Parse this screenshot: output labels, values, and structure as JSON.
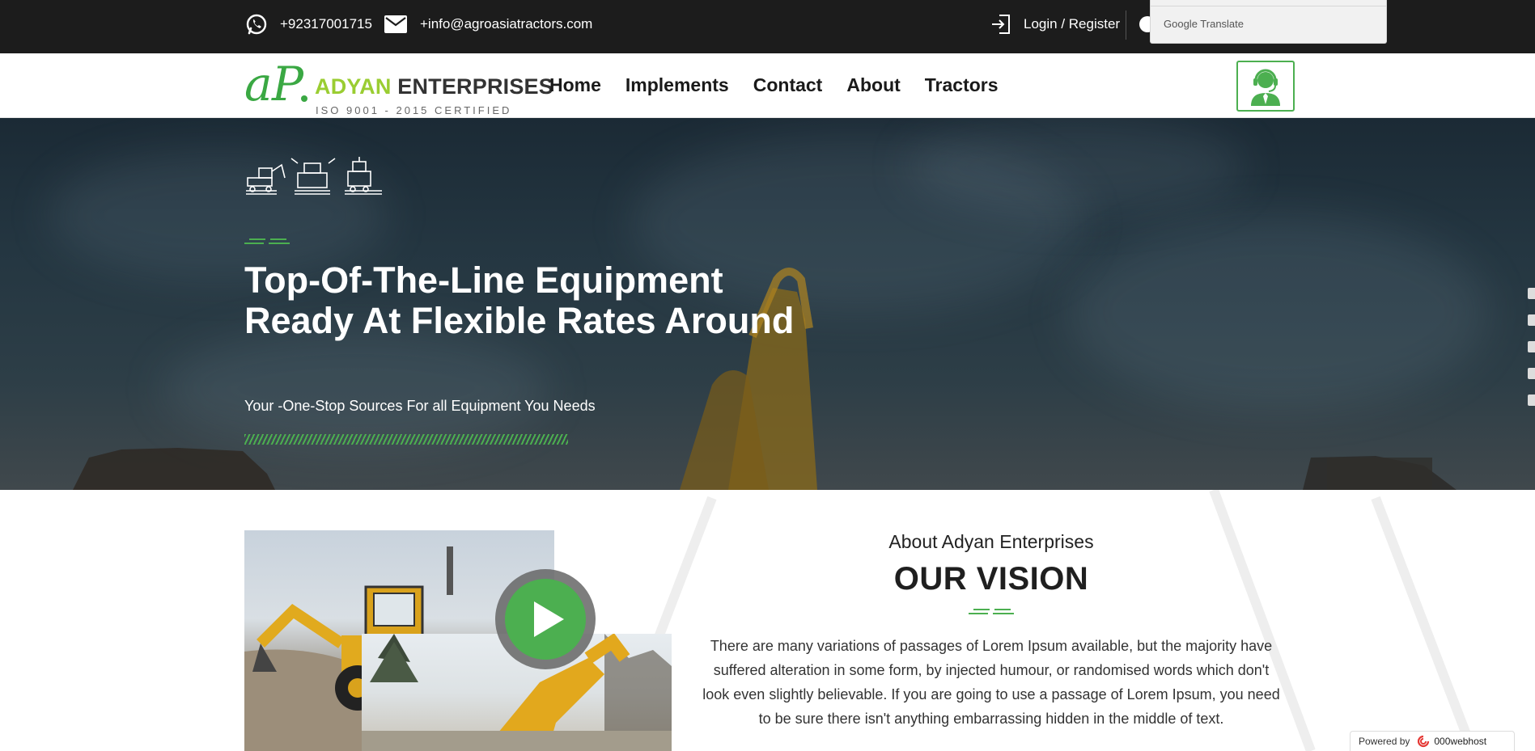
{
  "topbar": {
    "phone": "+92317001715",
    "email": "+info@agroasiatractors.com",
    "login": "Login / Register",
    "translate_label": "Google Translate",
    "icons": [
      "whatsapp-icon",
      "mail-icon",
      "login-icon",
      "globe-icon"
    ]
  },
  "header": {
    "logo_mark": "aP.",
    "logo_brand_1": "ADYAN",
    "logo_brand_2": " ENTERPRISES",
    "logo_cert": "ISO 9001 - 2015 CERTIFIED",
    "nav": [
      "Home",
      "Implements",
      "Contact",
      "About",
      "Tractors"
    ],
    "support_icon": "customer-support-icon"
  },
  "hero": {
    "title": "Top-Of-The-Line Equipment Ready At Flexible Rates Around",
    "subtitle": "Your -One-Stop Sources For all Equipment You Needs",
    "icons": [
      "excavator-line-icon",
      "tractor-line-icon",
      "combine-line-icon"
    ]
  },
  "about": {
    "eyebrow": "About Adyan Enterprises",
    "heading": "OUR VISION",
    "body": "There are many variations of passages of Lorem Ipsum available, but the majority have suffered alteration in some form, by injected humour, or randomised words which don't look even slightly believable. If you are going to use a passage of Lorem Ipsum, you need to be sure there isn't anything embarrassing hidden in the middle of text.",
    "play_icon": "play-icon"
  },
  "footer_badge": {
    "powered": "Powered by",
    "brand": "000webhost"
  },
  "colors": {
    "accent": "#4caf50",
    "logo_green": "#9acd32",
    "topbar": "#1c1c1c",
    "hero_bg": "#243641"
  }
}
